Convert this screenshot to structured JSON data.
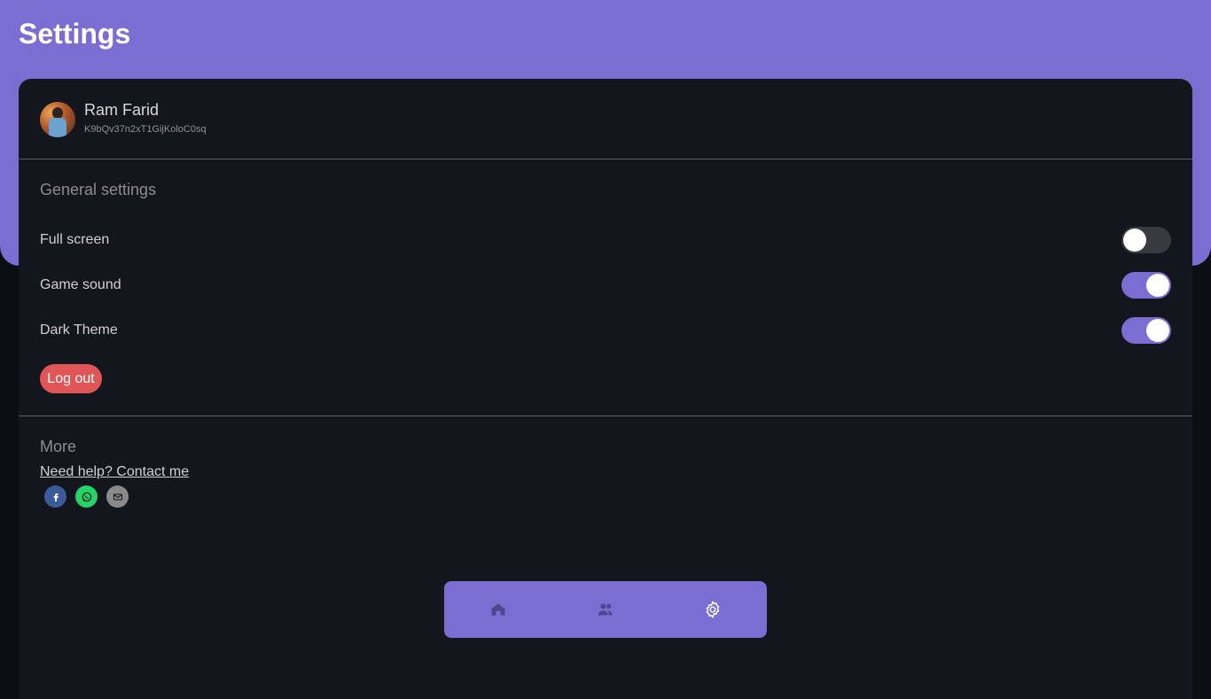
{
  "header": {
    "title": "Settings"
  },
  "profile": {
    "name": "Ram Farid",
    "user_id": "K9bQv37n2xT1GijKoloC0sq"
  },
  "general": {
    "section_title": "General settings",
    "settings": [
      {
        "label": "Full screen",
        "enabled": false
      },
      {
        "label": "Game sound",
        "enabled": true
      },
      {
        "label": "Dark Theme",
        "enabled": true
      }
    ],
    "logout_label": "Log out"
  },
  "more": {
    "section_title": "More",
    "help_link": "Need help? Contact me",
    "social_icons": [
      "facebook-icon",
      "whatsapp-icon",
      "mail-icon"
    ]
  },
  "nav": {
    "items": [
      "home-icon",
      "friends-icon",
      "settings-icon"
    ],
    "active": "settings-icon"
  },
  "colors": {
    "accent": "#7b6dd1",
    "background": "#13161d",
    "logout": "#e05656",
    "toggle_off": "#383a3f"
  }
}
